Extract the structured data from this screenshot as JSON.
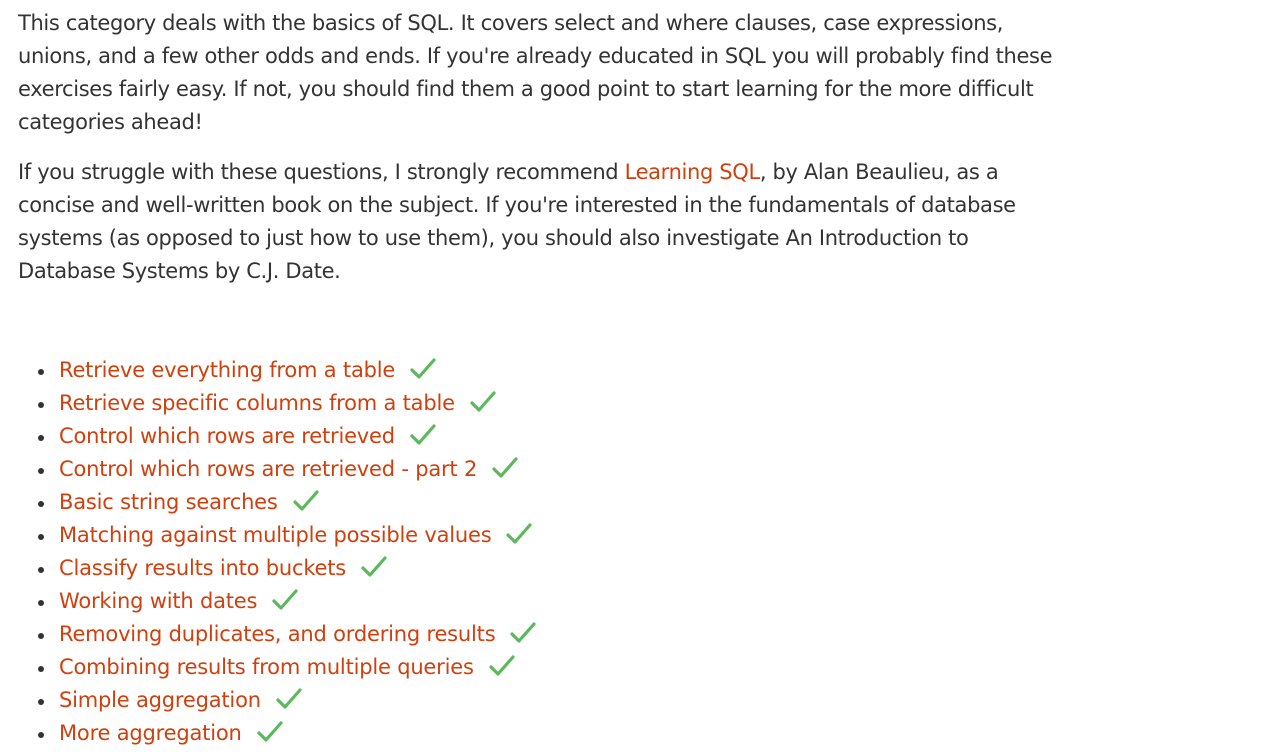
{
  "intro": {
    "paragraph1": "This category deals with the basics of SQL. It covers select and where clauses, case expressions, unions, and a few other odds and ends. If you're already educated in SQL you will probably find these exercises fairly easy. If not, you should find them a good point to start learning for the more difficult categories ahead!",
    "paragraph2_before_link": "If you struggle with these questions, I strongly recommend ",
    "paragraph2_link": "Learning SQL",
    "paragraph2_after_link": ", by Alan Beaulieu, as a concise and well-written book on the subject. If you're interested in the fundamentals of database systems (as opposed to just how to use them), you should also investigate An Introduction to Database Systems by C.J. Date."
  },
  "exercises": [
    {
      "label": "Retrieve everything from a table",
      "completed": true
    },
    {
      "label": "Retrieve specific columns from a table",
      "completed": true
    },
    {
      "label": "Control which rows are retrieved",
      "completed": true
    },
    {
      "label": "Control which rows are retrieved - part 2",
      "completed": true
    },
    {
      "label": "Basic string searches",
      "completed": true
    },
    {
      "label": "Matching against multiple possible values",
      "completed": true
    },
    {
      "label": "Classify results into buckets",
      "completed": true
    },
    {
      "label": "Working with dates",
      "completed": true
    },
    {
      "label": "Removing duplicates, and ordering results",
      "completed": true
    },
    {
      "label": "Combining results from multiple queries",
      "completed": true
    },
    {
      "label": "Simple aggregation",
      "completed": true
    },
    {
      "label": "More aggregation",
      "completed": true
    }
  ],
  "colors": {
    "link": "#d0400e",
    "text": "#333333",
    "check": "#5cb85c"
  },
  "icons": {
    "completed": "checkmark-icon"
  }
}
